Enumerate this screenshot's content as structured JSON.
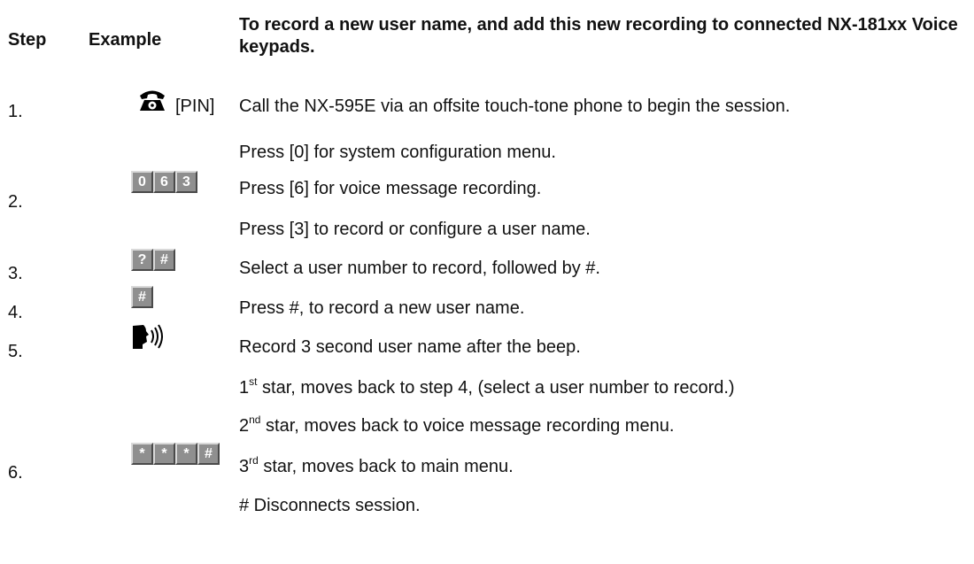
{
  "header": {
    "step_label": "Step",
    "example_label": "Example",
    "title": "To record a new user name, and add this new recording to connected NX-181xx Voice keypads."
  },
  "icons": {
    "phone": "phone-icon",
    "speech": "speaking-head-icon",
    "keypad_key": "keypad-key-icon"
  },
  "steps": [
    {
      "number": "1.",
      "example_text": "[PIN]",
      "lines": [
        "Call the NX-595E via an offsite touch-tone phone to begin the session."
      ]
    },
    {
      "number": "2.",
      "keys": [
        "0",
        "6",
        "3"
      ],
      "lines": [
        "Press [0] for system configuration menu.",
        "Press [6] for voice message recording.",
        "Press [3] to record or configure a user name."
      ]
    },
    {
      "number": "3.",
      "keys": [
        "?",
        "#"
      ],
      "lines": [
        "Select a user number to record, followed by #."
      ]
    },
    {
      "number": "4.",
      "keys": [
        "#"
      ],
      "lines": [
        "Press #, to record a new user name."
      ]
    },
    {
      "number": "5.",
      "lines": [
        "Record 3 second user name after the beep."
      ]
    },
    {
      "number": "6.",
      "keys": [
        "*",
        "*",
        "*",
        "#"
      ],
      "lines": [
        {
          "lead": "1",
          "sup": "st",
          "rest": " star, moves back to step 4, (select a user number to record.)"
        },
        {
          "lead": "2",
          "sup": "nd",
          "rest": " star, moves back to voice message recording menu."
        },
        {
          "lead": "3",
          "sup": "rd",
          "rest": " star, moves back to main menu."
        },
        "# Disconnects session."
      ]
    }
  ]
}
